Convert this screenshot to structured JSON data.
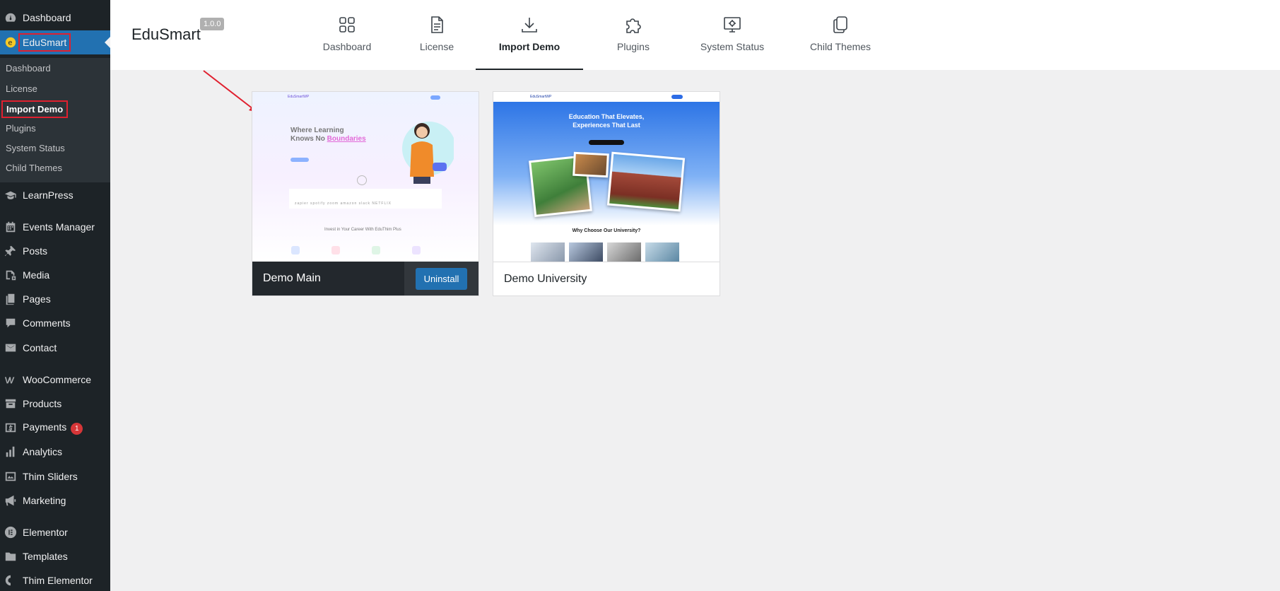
{
  "sidebar": {
    "items": [
      {
        "label": "Dashboard",
        "icon": "dashboard-icon"
      },
      {
        "label": "EduSmart",
        "icon": "edusmart-logo-icon"
      },
      {
        "label": "LearnPress",
        "icon": "graduation-cap-icon"
      },
      {
        "label": "Events Manager",
        "icon": "calendar-icon"
      },
      {
        "label": "Posts",
        "icon": "pushpin-icon"
      },
      {
        "label": "Media",
        "icon": "media-icon"
      },
      {
        "label": "Pages",
        "icon": "pages-icon"
      },
      {
        "label": "Comments",
        "icon": "comments-icon"
      },
      {
        "label": "Contact",
        "icon": "envelope-icon"
      },
      {
        "label": "WooCommerce",
        "icon": "woocommerce-icon"
      },
      {
        "label": "Products",
        "icon": "archive-icon"
      },
      {
        "label": "Payments",
        "icon": "dollar-icon",
        "badge": "1"
      },
      {
        "label": "Analytics",
        "icon": "bar-chart-icon"
      },
      {
        "label": "Thim Sliders",
        "icon": "slides-icon"
      },
      {
        "label": "Marketing",
        "icon": "megaphone-icon"
      },
      {
        "label": "Elementor",
        "icon": "elementor-icon"
      },
      {
        "label": "Templates",
        "icon": "folder-icon"
      },
      {
        "label": "Thim Elementor",
        "icon": "thim-elementor-icon"
      }
    ],
    "submenu": [
      "Dashboard",
      "License",
      "Import Demo",
      "Plugins",
      "System Status",
      "Child Themes"
    ]
  },
  "header": {
    "brand": "EduSmart",
    "version": "1.0.0",
    "tabs": [
      {
        "label": "Dashboard",
        "icon": "grid-icon"
      },
      {
        "label": "License",
        "icon": "document-icon"
      },
      {
        "label": "Import Demo",
        "icon": "download-icon"
      },
      {
        "label": "Plugins",
        "icon": "puzzle-icon"
      },
      {
        "label": "System Status",
        "icon": "monitor-gear-icon"
      },
      {
        "label": "Child Themes",
        "icon": "copy-icon"
      }
    ]
  },
  "demos": [
    {
      "name": "Demo Main",
      "button": "Uninstall",
      "preview": {
        "brand": "EduSmartWP",
        "hero_line1": "Where Learning",
        "hero_line2_prefix": "Knows No ",
        "hero_line2_highlight": "Boundaries",
        "logos": "zapier  spotify  zoom  amazon  slack  NETFLIX",
        "section_title": "Invest in Your Career With EduThim Plus"
      }
    },
    {
      "name": "Demo University",
      "preview": {
        "brand": "EduSmartWP",
        "hero_line1": "Education That Elevates,",
        "hero_line2": "Experiences That Last",
        "section_title": "Why Choose Our University?"
      }
    }
  ],
  "colors": {
    "accent": "#2271b1",
    "highlight": "#e0202f",
    "sidebar_bg": "#1d2327"
  }
}
